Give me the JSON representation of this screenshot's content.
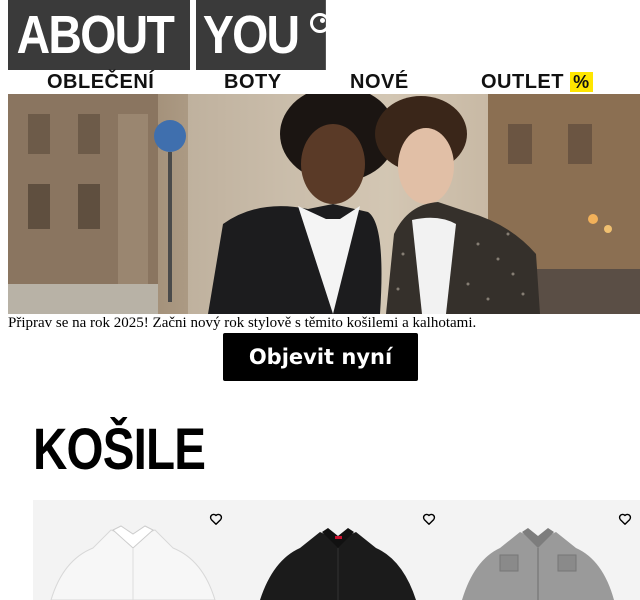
{
  "brand": {
    "logo_part1": "ABOUT",
    "logo_part2": "YOU",
    "logo_bg": "#3a3a3a"
  },
  "nav": {
    "items": [
      {
        "label": "OBLEČENÍ"
      },
      {
        "label": "BOTY"
      },
      {
        "label": "NOVÉ"
      },
      {
        "label": "OUTLET"
      }
    ],
    "outlet_badge": "%",
    "badge_color": "#ffe600"
  },
  "hero": {
    "image": "two-young-men-in-blazers-on-city-street"
  },
  "promo": {
    "text": "Připrav se na rok 2025! Začni nový rok stylově s těmito košilemi a kalhotami.",
    "cta_label": "Objevit nyní"
  },
  "section": {
    "title": "KOŠILE"
  },
  "products": [
    {
      "name": "white-shirt",
      "color": "#f5f5f5",
      "icon": "heart-icon"
    },
    {
      "name": "black-shirt",
      "color": "#1a1a1a",
      "icon": "heart-icon"
    },
    {
      "name": "grey-shirt",
      "color": "#8e8e8e",
      "icon": "heart-icon"
    }
  ]
}
